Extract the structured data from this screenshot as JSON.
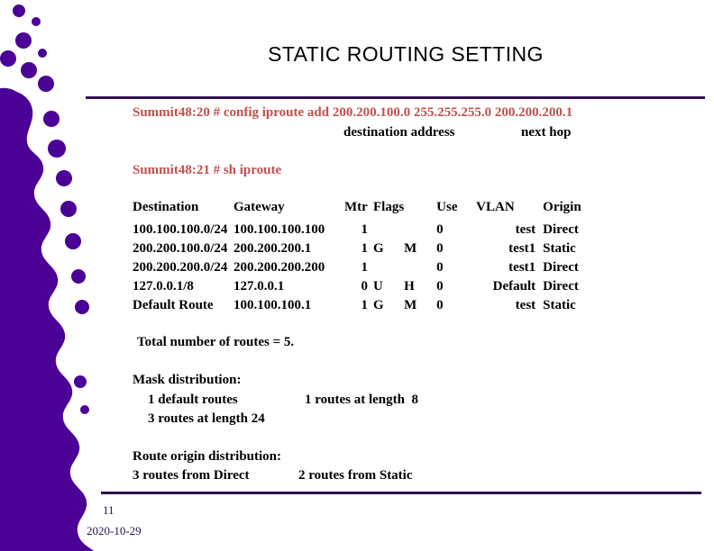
{
  "slide": {
    "title": "STATIC ROUTING SETTING",
    "accent_purple": "#4B0096",
    "rule_color": "#2E1050",
    "command_color": "#C0504D",
    "background": "#ffffff"
  },
  "commands": {
    "line1": "Summit48:20 # config iproute add 200.200.100.0 255.255.255.0 200.200.200.1",
    "label_destination": "destination address",
    "label_next_hop": "next hop",
    "line2": "Summit48:21 # sh iproute"
  },
  "route_table": {
    "headers": {
      "destination": "Destination",
      "gateway": "Gateway",
      "mtr": "Mtr",
      "flags": "Flags",
      "use": "Use",
      "vlan": "VLAN",
      "origin": "Origin"
    },
    "rows": [
      {
        "destination": "100.100.100.0/24",
        "gateway": "100.100.100.100",
        "mtr": "1",
        "flag1": "",
        "flag2": "",
        "use": "0",
        "vlan": "test",
        "origin": "Direct"
      },
      {
        "destination": "200.200.100.0/24",
        "gateway": "200.200.200.1",
        "mtr": "1",
        "flag1": "G",
        "flag2": "M",
        "use": "0",
        "vlan": "test1",
        "origin": "Static"
      },
      {
        "destination": "200.200.200.0/24",
        "gateway": "200.200.200.200",
        "mtr": "1",
        "flag1": "",
        "flag2": "",
        "use": "0",
        "vlan": "test1",
        "origin": "Direct"
      },
      {
        "destination": "127.0.0.1/8",
        "gateway": "127.0.0.1",
        "mtr": "0",
        "flag1": "U",
        "flag2": "H",
        "use": "0",
        "vlan": "Default",
        "origin": "Direct"
      },
      {
        "destination": "Default Route",
        "gateway": "100.100.100.1",
        "mtr": "1",
        "flag1": "G",
        "flag2": "M",
        "use": "0",
        "vlan": "test",
        "origin": "Static"
      }
    ]
  },
  "summary": {
    "total_routes": "Total number of routes = 5.",
    "mask_heading": "Mask distribution:",
    "mask_default": "1 default routes",
    "mask_len8": "1 routes at length  8",
    "mask_len24": "3 routes at length 24",
    "origin_heading": "Route origin distribution:",
    "origin_direct": "3 routes from Direct",
    "origin_static": "2 routes from Static"
  },
  "footer": {
    "page_number": "11",
    "date": "2020-10-29"
  }
}
